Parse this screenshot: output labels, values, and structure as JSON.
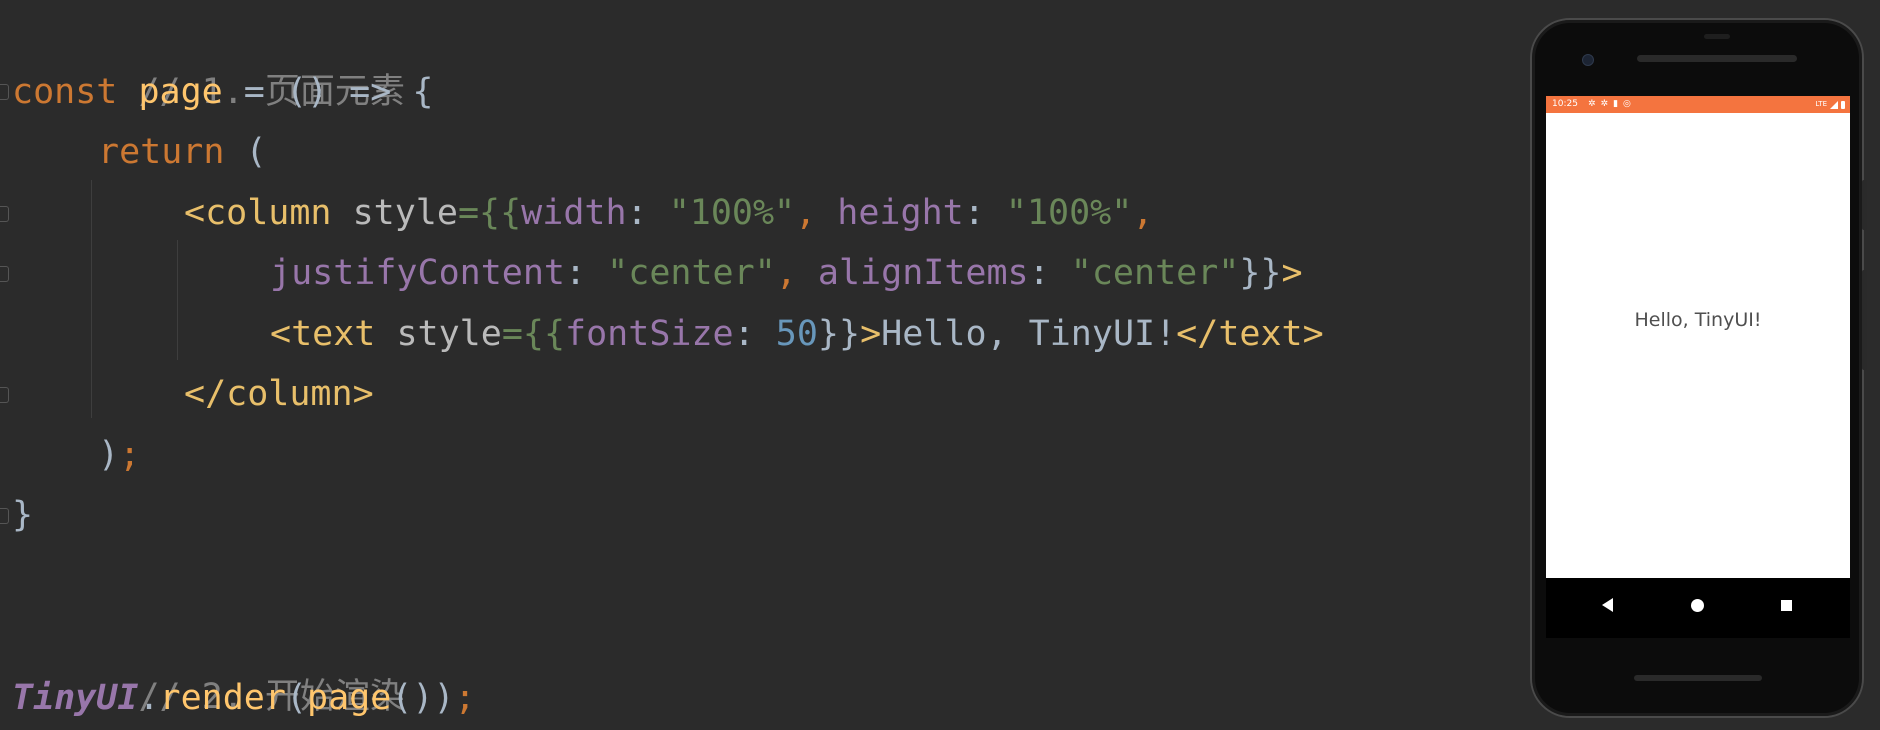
{
  "code": {
    "comment1": "// 1. 页面元素",
    "line2": {
      "kw": "const",
      "fn": "page",
      "rest": " = () => {"
    },
    "line3": {
      "kw": "return",
      "rest": " ("
    },
    "line4": {
      "lt": "<",
      "tag": "column",
      "attr": " style",
      "eq": "={{",
      "p1": "width",
      "colon1": ": ",
      "v1": "\"100%\"",
      "comma1": ", ",
      "p2": "height",
      "colon2": ": ",
      "v2": "\"100%\"",
      "comma2": ","
    },
    "line5": {
      "p1": "justifyContent",
      "colon1": ": ",
      "v1": "\"center\"",
      "comma1": ", ",
      "p2": "alignItems",
      "colon2": ": ",
      "v2": "\"center\"",
      "close": "}}",
      "gt": ">"
    },
    "line6": {
      "lt": "<",
      "tag": "text",
      "attr": " style",
      "eq": "={{",
      "p1": "fontSize",
      "colon1": ": ",
      "v1": "50",
      "close": "}}",
      "gt": ">",
      "content": "Hello, TinyUI!",
      "endtag": "</text>"
    },
    "line7": {
      "endtag": "</column>"
    },
    "line8": {
      "paren": ")",
      "semi": ";"
    },
    "line9": "}",
    "comment2": "// 2. 开始渲染",
    "line11": {
      "obj": "TinyUI",
      "dot": ".",
      "fn": "render",
      "open": "(",
      "arg": "page",
      "close": "())",
      "semi": ";"
    }
  },
  "phone": {
    "status_time": "10:25",
    "status_network": "LTE",
    "app_text": "Hello, TinyUI!"
  }
}
